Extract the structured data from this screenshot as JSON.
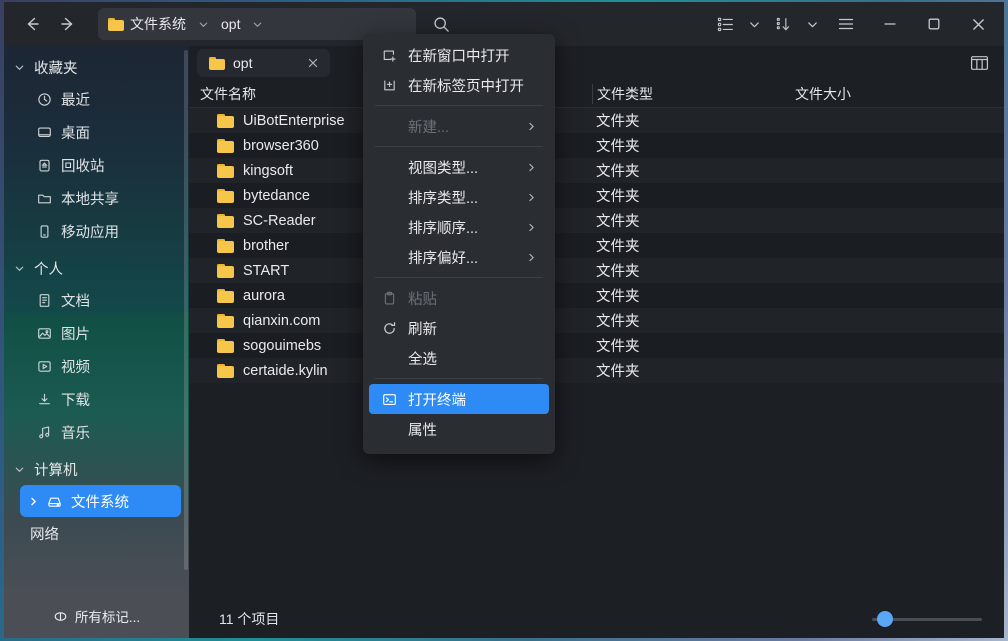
{
  "window": {
    "title": "opt"
  },
  "toolbar": {
    "back_icon": "arrow-left-icon",
    "forward_icon": "arrow-right-icon",
    "address": {
      "root_label": "文件系统",
      "root_icon": "folder-icon",
      "current_label": "opt",
      "chevron": "chevron-down-icon"
    },
    "search_icon": "search-icon",
    "view_mode_icon": "list-view-icon",
    "view_mode_chevron": "chevron-down-icon",
    "sort_icon": "sort-descending-icon",
    "sort_chevron": "chevron-down-icon",
    "menu_icon": "hamburger-menu-icon",
    "minimize_icon": "minimize-icon",
    "maximize_icon": "maximize-icon",
    "close_icon": "close-icon"
  },
  "sidebar": {
    "groups": [
      {
        "label": "收藏夹",
        "items": [
          {
            "label": "最近",
            "icon": "clock-icon"
          },
          {
            "label": "桌面",
            "icon": "monitor-icon"
          },
          {
            "label": "回收站",
            "icon": "trash-icon"
          },
          {
            "label": "本地共享",
            "icon": "folder-icon"
          },
          {
            "label": "移动应用",
            "icon": "mobile-app-icon"
          }
        ]
      },
      {
        "label": "个人",
        "items": [
          {
            "label": "文档",
            "icon": "document-icon"
          },
          {
            "label": "图片",
            "icon": "image-icon"
          },
          {
            "label": "视频",
            "icon": "video-icon"
          },
          {
            "label": "下载",
            "icon": "download-icon"
          },
          {
            "label": "音乐",
            "icon": "music-icon"
          }
        ]
      },
      {
        "label": "计算机",
        "items": [
          {
            "label": "文件系统",
            "icon": "drive-icon",
            "selected": true,
            "expander": "chevron-right-icon"
          }
        ]
      }
    ],
    "network_label": "网络",
    "all_tags": {
      "label": "所有标记...",
      "icon": "tag-icon"
    }
  },
  "tab": {
    "label": "opt",
    "icon": "folder-icon",
    "close_icon": "close-icon"
  },
  "panel_toggle_icon": "columns-panel-icon",
  "filelist": {
    "columns": [
      "文件名称",
      "文件类型",
      "文件大小"
    ],
    "rows": [
      {
        "name": "UiBotEnterprise",
        "type": "文件夹",
        "size": ""
      },
      {
        "name": "browser360",
        "type": "文件夹",
        "size": ""
      },
      {
        "name": "kingsoft",
        "type": "文件夹",
        "size": ""
      },
      {
        "name": "bytedance",
        "type": "文件夹",
        "size": ""
      },
      {
        "name": "SC-Reader",
        "type": "文件夹",
        "size": ""
      },
      {
        "name": "brother",
        "type": "文件夹",
        "size": ""
      },
      {
        "name": "START",
        "type": "文件夹",
        "size": ""
      },
      {
        "name": "aurora",
        "type": "文件夹",
        "size": ""
      },
      {
        "name": "qianxin.com",
        "type": "文件夹",
        "size": ""
      },
      {
        "name": "sogouimebs",
        "type": "文件夹",
        "size": ""
      },
      {
        "name": "certaide.kylin",
        "type": "文件夹",
        "size": ""
      }
    ]
  },
  "statusbar": {
    "item_count": "11 个项目",
    "zoom_value": 8
  },
  "context_menu": {
    "items": [
      {
        "label": "在新窗口中打开",
        "icon": "new-window-icon",
        "state": "normal"
      },
      {
        "label": "在新标签页中打开",
        "icon": "new-tab-icon",
        "state": "normal"
      },
      {
        "type": "separator"
      },
      {
        "label": "新建...",
        "icon": "",
        "state": "disabled",
        "arrow": "chevron-right-icon"
      },
      {
        "type": "separator"
      },
      {
        "label": "视图类型...",
        "icon": "",
        "state": "normal",
        "arrow": "chevron-right-icon"
      },
      {
        "label": "排序类型...",
        "icon": "",
        "state": "normal",
        "arrow": "chevron-right-icon"
      },
      {
        "label": "排序顺序...",
        "icon": "",
        "state": "normal",
        "arrow": "chevron-right-icon"
      },
      {
        "label": "排序偏好...",
        "icon": "",
        "state": "normal",
        "arrow": "chevron-right-icon"
      },
      {
        "type": "separator"
      },
      {
        "label": "粘贴",
        "icon": "clipboard-icon",
        "state": "disabled"
      },
      {
        "label": "刷新",
        "icon": "refresh-icon",
        "state": "normal"
      },
      {
        "label": "全选",
        "icon": "",
        "state": "normal"
      },
      {
        "type": "separator"
      },
      {
        "label": "打开终端",
        "icon": "terminal-icon",
        "state": "highlight"
      },
      {
        "label": "属性",
        "icon": "",
        "state": "normal"
      }
    ]
  },
  "colors": {
    "accent": "#2e8bf5",
    "window_bg": "#1c1f24",
    "titlebar_bg": "#23262b",
    "menu_bg": "#2a2d32",
    "folder_yellow": "#f5c64a"
  }
}
